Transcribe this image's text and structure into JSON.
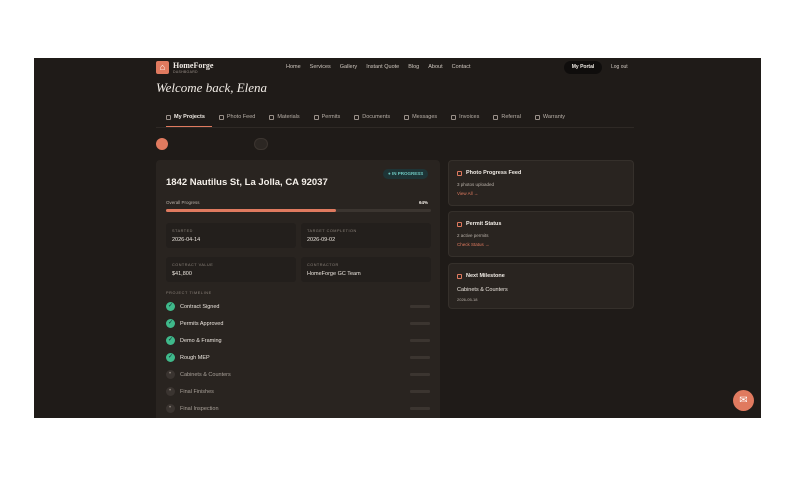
{
  "brand": {
    "name": "HomeForge",
    "tagline": "DASHBOARD"
  },
  "nav": {
    "links": [
      "Home",
      "Services",
      "Gallery",
      "Instant Quote",
      "Blog",
      "About",
      "Contact"
    ],
    "portal_label": "My Portal",
    "logout_label": "Log out"
  },
  "welcome": "Welcome back, Elena",
  "tabs": [
    {
      "label": "My Projects",
      "icon": "folder-icon"
    },
    {
      "label": "Photo Feed",
      "icon": "image-icon"
    },
    {
      "label": "Materials",
      "icon": "box-icon"
    },
    {
      "label": "Permits",
      "icon": "shield-icon"
    },
    {
      "label": "Documents",
      "icon": "document-icon"
    },
    {
      "label": "Messages",
      "icon": "message-icon"
    },
    {
      "label": "Invoices",
      "icon": "invoice-icon"
    },
    {
      "label": "Referral",
      "icon": "share-icon"
    },
    {
      "label": "Warranty",
      "icon": "badge-icon"
    }
  ],
  "projects": [],
  "project": {
    "address": "1842 Nautilus St, La Jolla, CA 92037",
    "status": "IN PROGRESS",
    "progress_label": "Overall Progress",
    "progress_pct": "64%",
    "progress_fraction": 0.64,
    "started_label": "STARTED",
    "started": "2026-04-14",
    "target_label": "TARGET COMPLETION",
    "target": "2026-09-02",
    "contract_label": "CONTRACT VALUE",
    "contract": "$41,800",
    "contractor_label": "CONTRACTOR",
    "contractor": "HomeForge GC Team",
    "timeline_head": "PROJECT TIMELINE",
    "timeline": [
      {
        "label": "Contract Signed",
        "done": true
      },
      {
        "label": "Permits Approved",
        "done": true
      },
      {
        "label": "Demo & Framing",
        "done": true
      },
      {
        "label": "Rough MEP",
        "done": true
      },
      {
        "label": "Cabinets & Counters",
        "done": false
      },
      {
        "label": "Final Finishes",
        "done": false
      },
      {
        "label": "Final Inspection",
        "done": false
      }
    ]
  },
  "side": {
    "photo": {
      "title": "Photo Progress Feed",
      "line": "3 photos uploaded",
      "link": "View All →"
    },
    "permit": {
      "title": "Permit Status",
      "line": "2 active permits",
      "link": "Check Status →"
    },
    "milestone": {
      "title": "Next Milestone",
      "line": "Cabinets & Counters",
      "date": "2026-05-18"
    }
  },
  "colors": {
    "accent": "#e07a5f",
    "background": "#1f1b18",
    "card": "#292420",
    "success": "#3fb98a",
    "status": "#6ec7c0"
  }
}
